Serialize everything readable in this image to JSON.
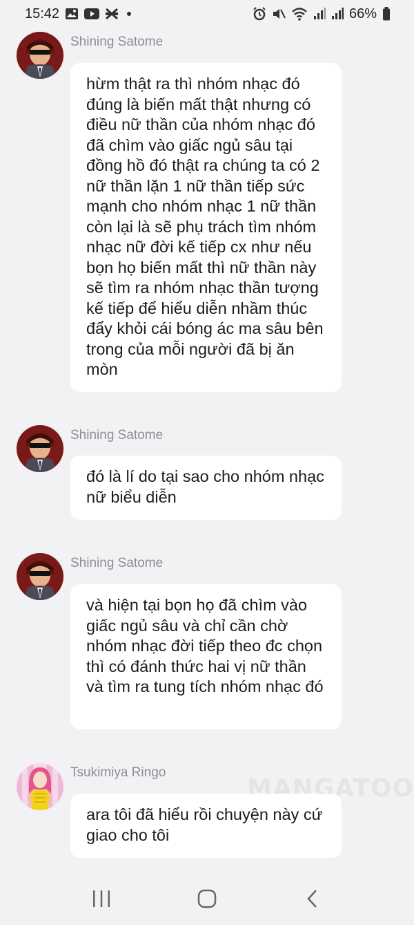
{
  "status_bar": {
    "time": "15:42",
    "battery": "66%",
    "icons_left": [
      "gallery-icon",
      "youtube-icon",
      "cut-icon",
      "notification-dot-icon"
    ],
    "icons_right": [
      "alarm-icon",
      "mute-icon",
      "wifi-icon",
      "signal-icon",
      "signal-icon",
      "battery-icon"
    ]
  },
  "messages": [
    {
      "sender": "Shining Satome",
      "avatar": "avatar-satome",
      "text": "hừm thật ra thì nhóm nhạc đó đúng là biến mất thật nhưng có điều nữ thần của nhóm nhạc đó  đã chìm vào giấc ngủ sâu tại đồng hồ đó thật ra chúng ta có 2 nữ thần lặn 1 nữ thần tiếp sức mạnh cho nhóm nhạc 1 nữ thần còn lại là sẽ phụ trách tìm nhóm nhạc nữ đời kế tiếp cx như nếu bọn họ biến mất thì nữ thần này sẽ tìm ra nhóm nhạc thần tượng kế tiếp để hiểu diễn nhầm thúc đẩy khỏi cái bóng ác ma sâu bên trong của mỗi người đã bị ăn mòn"
    },
    {
      "sender": "Shining Satome",
      "avatar": "avatar-satome",
      "text": "đó là lí do tại sao cho nhóm nhạc nữ biểu diễn"
    },
    {
      "sender": "Shining Satome",
      "avatar": "avatar-satome",
      "text": "và hiện tại bọn họ đã chìm vào giấc ngủ sâu và chỉ cần chờ nhóm nhạc đời tiếp theo đc chọn thì có đánh thức hai vị nữ thần và tìm ra tung tích nhóm nhạc đó"
    },
    {
      "sender": "Tsukimiya Ringo",
      "avatar": "avatar-ringo",
      "text": "ara tôi đã hiểu rồi chuyện này cứ giao cho tôi"
    }
  ],
  "watermark": "MANGATOON",
  "nav_bar": {
    "buttons": [
      "recents-icon",
      "home-icon",
      "back-icon"
    ]
  }
}
